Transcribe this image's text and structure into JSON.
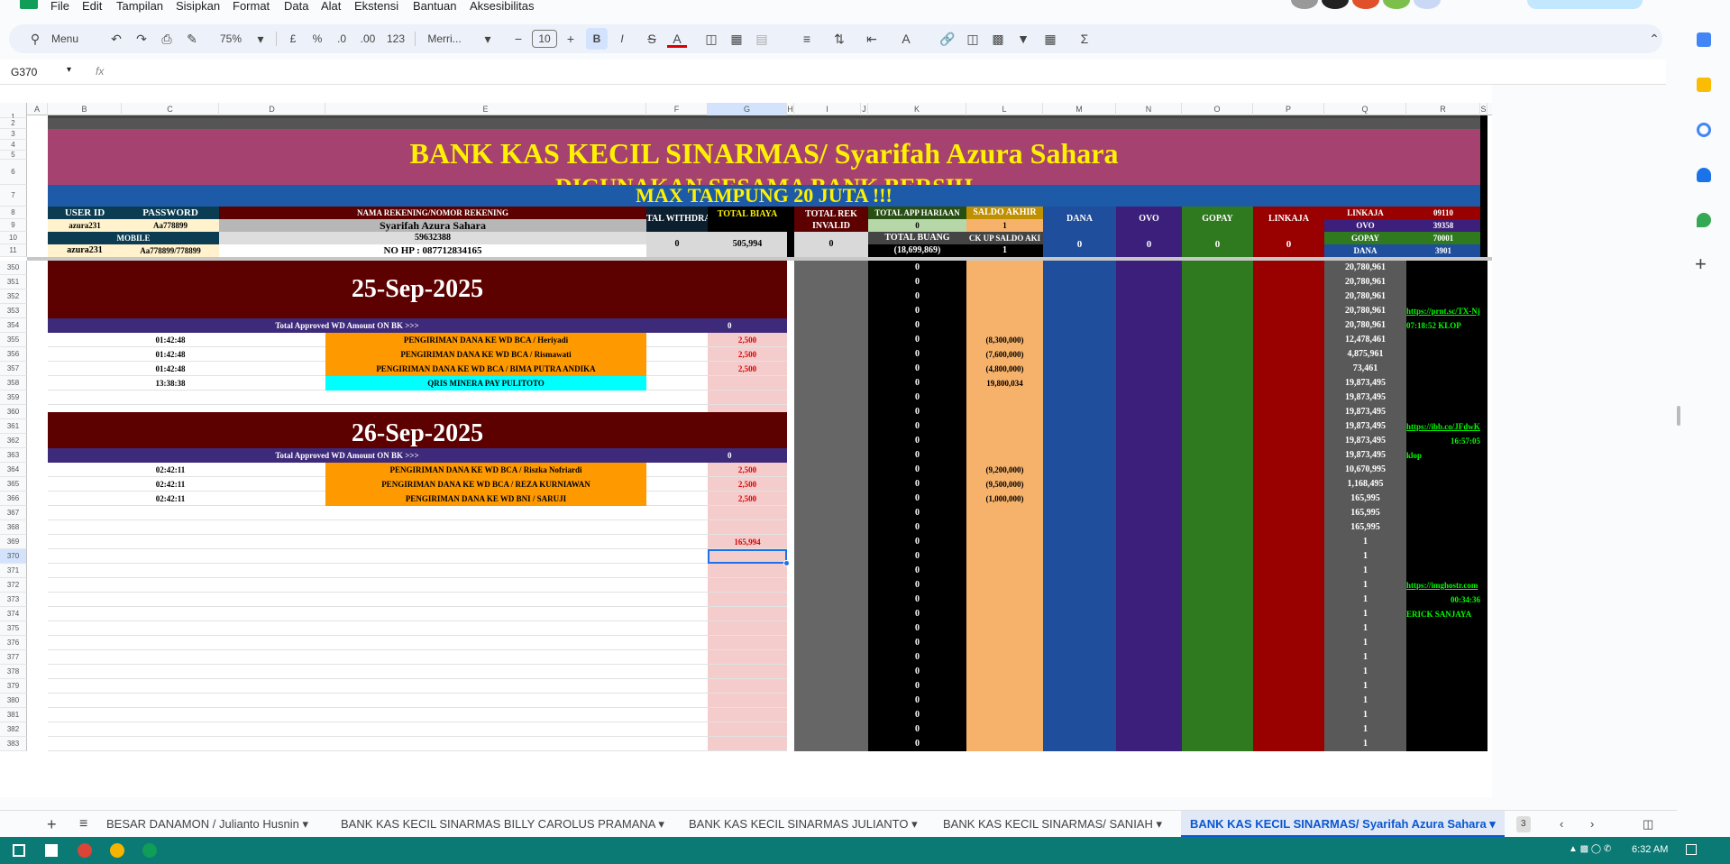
{
  "menus": [
    "File",
    "Edit",
    "Tampilan",
    "Sisipkan",
    "Format",
    "Data",
    "Alat",
    "Ekstensi",
    "Bantuan",
    "Aksesibilitas"
  ],
  "toolbar": {
    "menu_label": "Menu",
    "zoom": "75%",
    "currency": "£",
    "percent": "%",
    "dec_minus": ".0",
    "dec_plus": ".00",
    "num_fmt": "123",
    "font": "Merri...",
    "font_size": "10",
    "bold": "B",
    "italic": "I"
  },
  "namebox": "G370",
  "fx": "fx",
  "columns": [
    "A",
    "B",
    "C",
    "D",
    "E",
    "F",
    "G",
    "H",
    "I",
    "J",
    "K",
    "L",
    "M",
    "N",
    "O",
    "P",
    "Q",
    "R",
    "S"
  ],
  "title1": "BANK KAS KECIL SINARMAS/ Syarifah Azura Sahara",
  "title2": "DIGUNAKAN SESAMA BANK BERSIH",
  "title3": "MAX TAMPUNG 20 JUTA !!!",
  "header": {
    "user_id_label": "USER ID",
    "password_label": "PASSWORD",
    "user_id": "azura231",
    "password": "Aa778899",
    "mobile_label": "MOBILE",
    "mobile_user": "azura231",
    "mobile_pass": "Aa778899/778899",
    "rek_label": "NAMA REKENING/NOMOR REKENING",
    "rek_name": "Syarifah Azura Sahara",
    "rek_no": "59632388",
    "nohp": "NO HP :  087712834165",
    "total_withdraw_label": "TAL WITHDRA",
    "total_withdraw": "0",
    "total_biaya_label": "TOTAL BIAYA",
    "total_biaya": "505,994",
    "rek_invalid_label": "TOTAL REK INVALID",
    "rek_invalid": "0",
    "app_harian_label": "TOTAL APP HARIAAN",
    "app_harian": "0",
    "saldo_akhir_label": "SALDO AKHIR",
    "saldo_akhir": "1",
    "total_buang_label": "TOTAL BUANG",
    "total_buang": "(18,699,869)",
    "backup_label": "CK UP SALDO AKI",
    "backup": "1",
    "dana_label": "DANA",
    "ovo_label": "OVO",
    "gopay_label": "GOPAY",
    "linkaja_label": "LINKAJA",
    "dana_val": "0",
    "ovo_val": "0",
    "gopay_val": "0",
    "linkaja_val": "0",
    "side": [
      {
        "k": "LINKAJA",
        "v": "09110"
      },
      {
        "k": "OVO",
        "v": "39358"
      },
      {
        "k": "GOPAY",
        "v": "70001"
      },
      {
        "k": "DANA",
        "v": "3901"
      }
    ]
  },
  "row_numbers": [
    "1",
    "2",
    "3",
    "4",
    "5",
    "6",
    "7",
    "8",
    "9",
    "10",
    "11",
    "350",
    "351",
    "352",
    "353",
    "354",
    "355",
    "356",
    "357",
    "358",
    "359",
    "360",
    "361",
    "362",
    "363",
    "364",
    "365",
    "366",
    "367",
    "368",
    "369",
    "370",
    "371",
    "372",
    "373",
    "374",
    "375",
    "376",
    "377",
    "378",
    "379",
    "380",
    "381",
    "382",
    "383"
  ],
  "date1": "25-Sep-2025",
  "date2": "26-Sep-2025",
  "approved_label": "Total Approved WD Amount ON BK >>>",
  "approved_val": "0",
  "tx1": [
    {
      "time": "01:42:48",
      "desc": "PENGIRIMAN DANA KE WD BCA / Heriyadi",
      "fee": "2,500",
      "l": "(8,300,000)",
      "q": "12,478,461",
      "type": "o"
    },
    {
      "time": "01:42:48",
      "desc": "PENGIRIMAN DANA KE WD BCA / Rismawati",
      "fee": "2,500",
      "l": "(7,600,000)",
      "q": "4,875,961",
      "type": "o"
    },
    {
      "time": "01:42:48",
      "desc": "PENGIRIMAN DANA KE WD BCA / BIMA PUTRA ANDIKA",
      "fee": "2,500",
      "l": "(4,800,000)",
      "q": "73,461",
      "type": "o"
    },
    {
      "time": "13:38:38",
      "desc": "QRIS MINERA PAY PULITOTO",
      "fee": "",
      "l": "19,800,034",
      "q": "19,873,495",
      "type": "c"
    }
  ],
  "tx2": [
    {
      "time": "02:42:11",
      "desc": "PENGIRIMAN DANA KE WD BCA / Riszka Nofriardi",
      "fee": "2,500",
      "l": "(9,200,000)",
      "q": "10,670,995"
    },
    {
      "time": "02:42:11",
      "desc": "PENGIRIMAN DANA KE WD BCA / REZA KURNIAWAN",
      "fee": "2,500",
      "l": "(9,500,000)",
      "q": "1,168,495"
    },
    {
      "time": "02:42:11",
      "desc": "PENGIRIMAN DANA KE WD BNI / SARUJI",
      "fee": "2,500",
      "l": "(1,000,000)",
      "q": "165,995"
    }
  ],
  "q_top": [
    "20,780,961",
    "20,780,961",
    "20,780,961",
    "20,780,961",
    "20,780,961"
  ],
  "q_mid": [
    "19,873,495",
    "19,873,495",
    "19,873,495",
    "19,873,495",
    "19,873,495"
  ],
  "q_after": [
    "165,995",
    "165,995",
    "1",
    "1",
    "1",
    "1",
    "1",
    "1",
    "1",
    "1",
    "1",
    "1",
    "1",
    "1",
    "1",
    "1",
    "1",
    "1"
  ],
  "g_total": "165,994",
  "links": [
    {
      "text": "https://prnt.sc/TX-Nj",
      "r": "353"
    },
    {
      "text": "07:18:52 KLOP",
      "r": "354"
    },
    {
      "text": "https://ibb.co/JFdwKi",
      "r": "361"
    },
    {
      "text": "16:57:05",
      "r": "362"
    },
    {
      "text": "klop",
      "r": "363"
    },
    {
      "text": "https://imghostr.com",
      "r": "372"
    },
    {
      "text": "00:34:36",
      "r": "373"
    },
    {
      "text": "ERICK SANJAYA",
      "r": "374"
    }
  ],
  "k_val": "0",
  "tabs": [
    "BESAR DANAMON / Julianto Husnin",
    "BANK KAS KECIL SINARMAS BILLY CAROLUS PRAMANA",
    "BANK KAS KECIL SINARMAS JULIANTO",
    "BANK KAS KECIL SINARMAS/ SANIAH",
    "BANK KAS KECIL SINARMAS/ Syarifah Azura Sahara"
  ],
  "tab_badge": "3",
  "clock": "6:32 AM",
  "colors": {
    "title_bg": "#a6426f",
    "title_yellow": "#fff200",
    "blue_band": "#1d5ba8",
    "dark_red": "#5c0000",
    "purple": "#3d2a7a",
    "orange": "#ff9900",
    "cyan": "#00ffff",
    "pink": "#f4cccc",
    "grey": "#666666",
    "black": "#000000",
    "lorange": "#f6b26b",
    "dana": "#1f4e9c",
    "ovo": "#3b1f7a",
    "gopay": "#2f7a1f",
    "linkaja": "#990000",
    "qgrey": "#595959"
  }
}
